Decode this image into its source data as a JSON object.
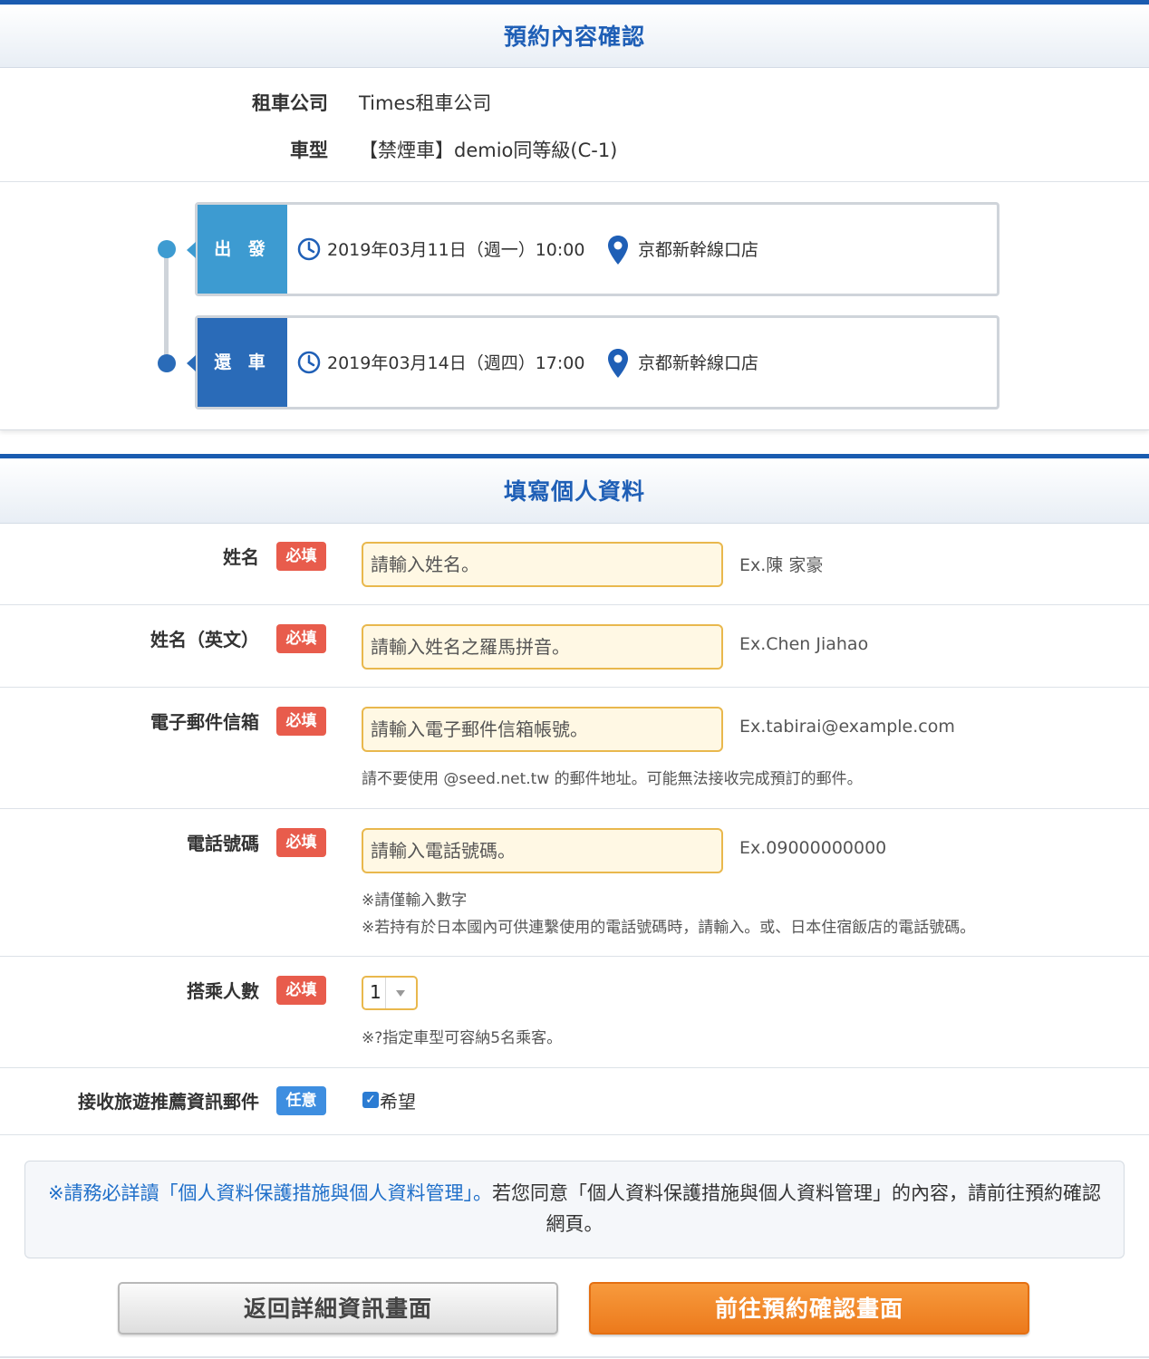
{
  "confirm_section": {
    "title": "預約內容確認",
    "company_label": "租車公司",
    "company_value": "Times租車公司",
    "car_label": "車型",
    "car_value": "【禁煙車】demio同等級(C-1)"
  },
  "trip": {
    "depart": {
      "tag": "出 發",
      "datetime": "2019年03月11日（週一）10:00",
      "location": "京都新幹線口店"
    },
    "return": {
      "tag": "還 車",
      "datetime": "2019年03月14日（週四）17:00",
      "location": "京都新幹線口店"
    }
  },
  "form_section": {
    "title": "填寫個人資料",
    "required_badge": "必填",
    "optional_badge": "任意",
    "name": {
      "label": "姓名",
      "placeholder": "請輸入姓名。",
      "example": "Ex.陳 家豪"
    },
    "name_en": {
      "label": "姓名（英文）",
      "placeholder": "請輸入姓名之羅馬拼音。",
      "example": "Ex.Chen Jiahao"
    },
    "email": {
      "label": "電子郵件信箱",
      "placeholder": "請輸入電子郵件信箱帳號。",
      "example": "Ex.tabirai@example.com",
      "note": "請不要使用 @seed.net.tw 的郵件地址。可能無法接收完成預訂的郵件。"
    },
    "phone": {
      "label": "電話號碼",
      "placeholder": "請輸入電話號碼。",
      "example": "Ex.09000000000",
      "note1": "※請僅輸入數字",
      "note2": "※若持有於日本國內可供連繫使用的電話號碼時，請輸入。或、日本住宿飯店的電話號碼。"
    },
    "passengers": {
      "label": "搭乘人數",
      "selected": "1",
      "note": "※?指定車型可容納5名乘客。"
    },
    "newsletter": {
      "label": "接收旅遊推薦資訊郵件",
      "checkbox_label": "希望",
      "checked": true
    }
  },
  "notice": {
    "link_text": "※請務必詳讀「個人資料保護措施與個人資料管理」。",
    "rest_text": "若您同意「個人資料保護措施與個人資料管理」的內容，請前往預約確認網頁。"
  },
  "buttons": {
    "back": "返回詳細資訊畫面",
    "next": "前往預約確認畫面"
  },
  "colors": {
    "header_text": "#1f5fb6",
    "header_border": "#1a5cb0",
    "depart_tag": "#3d9bd1",
    "return_tag": "#2a6bb8",
    "required_badge": "#e85c4c",
    "optional_badge": "#3e8ee0",
    "input_bg": "#fff8e4",
    "input_border": "#e9b84d",
    "next_button": "#ec7a1c",
    "link": "#1f6fc9"
  }
}
